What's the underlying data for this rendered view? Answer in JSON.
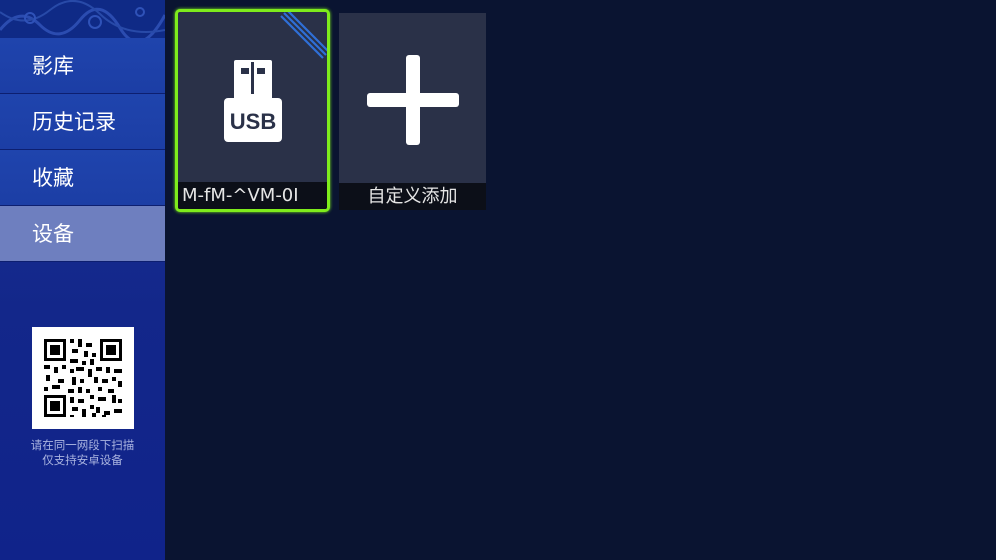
{
  "sidebar": {
    "items": [
      {
        "label": "影库",
        "active": false
      },
      {
        "label": "历史记录",
        "active": false
      },
      {
        "label": "收藏",
        "active": false
      },
      {
        "label": "设备",
        "active": true
      }
    ],
    "qr_icon": "qr-code-icon",
    "qr_caption_line1": "请在同一网段下扫描",
    "qr_caption_line2": "仅支持安卓设备"
  },
  "devices": [
    {
      "label": "M-fM-^VM-0I",
      "icon": "usb-drive-icon",
      "focused": true
    },
    {
      "label": "自定义添加",
      "icon": "plus-icon",
      "focused": false
    }
  ],
  "colors": {
    "background": "#0a1431",
    "sidebar": "#1c3ea5",
    "active_item": "#6e7fbf",
    "focus_border": "#7eec1c",
    "tile": "#2a3148"
  }
}
